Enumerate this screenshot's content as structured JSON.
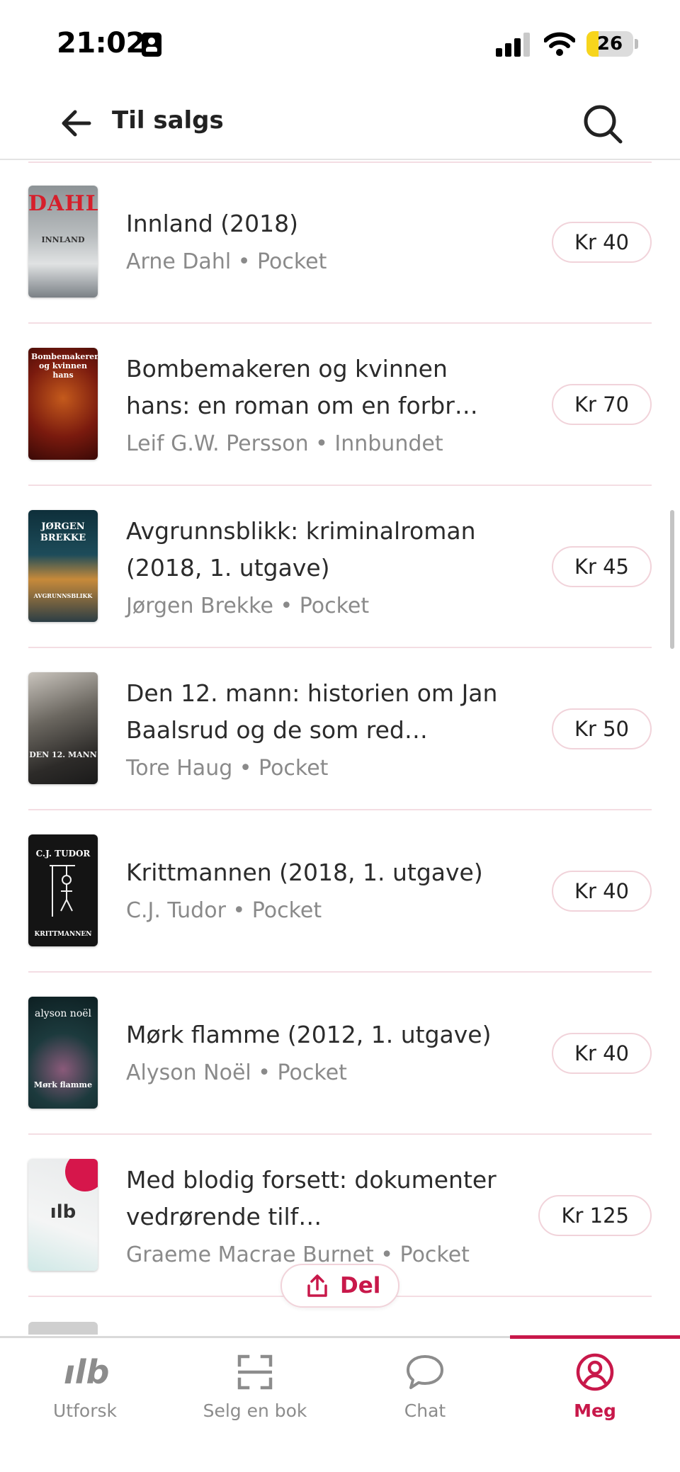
{
  "status_bar": {
    "time": "21:02",
    "battery": "26",
    "battery_level": 0.26
  },
  "header": {
    "title": "Til salgs"
  },
  "books": [
    {
      "title": "Innland (2018)",
      "author": "Arne Dahl",
      "format": "Pocket",
      "price": "Kr 40",
      "cover_text": "DAHL",
      "cover_sub": "INNLAND"
    },
    {
      "title": "Bombemakeren og kvinnen hans: en roman om en forbr…",
      "author": "Leif G.W. Persson",
      "format": "Innbundet",
      "price": "Kr 70",
      "cover_text": "Bombemakeren og kvinnen hans"
    },
    {
      "title": "Avgrunnsblikk: kriminalroman (2018, 1. utgave)",
      "author": "Jørgen Brekke",
      "format": "Pocket",
      "price": "Kr 45",
      "cover_text": "JØRGEN BREKKE",
      "cover_sub": "AVGRUNNSBLIKK"
    },
    {
      "title": "Den 12. mann: historien om Jan Baalsrud og de som red…",
      "author": "Tore Haug",
      "format": "Pocket",
      "price": "Kr 50",
      "cover_text": "DEN 12. MANN"
    },
    {
      "title": "Krittmannen (2018, 1. utgave)",
      "author": "C.J. Tudor",
      "format": "Pocket",
      "price": "Kr 40",
      "cover_text": "C.J. TUDOR",
      "cover_sub": "KRITTMANNEN"
    },
    {
      "title": "Mørk flamme (2012, 1. utgave)",
      "author": "Alyson Noël",
      "format": "Pocket",
      "price": "Kr 40",
      "cover_text": "alyson noël",
      "cover_sub": "Mørk flamme"
    },
    {
      "title": "Med blodig forsett: dokumenter vedrørende tilf…",
      "author": "Graeme Macrae Burnet",
      "format": "Pocket",
      "price": "Kr 125",
      "cover_text": "ılb"
    }
  ],
  "meta_separator": "•",
  "share": {
    "label": "Del"
  },
  "tabs": [
    {
      "label": "Utforsk",
      "icon": "logo-icon"
    },
    {
      "label": "Selg en bok",
      "icon": "scan-icon"
    },
    {
      "label": "Chat",
      "icon": "chat-bubble-icon"
    },
    {
      "label": "Meg",
      "icon": "profile-icon",
      "active": true
    }
  ],
  "colors": {
    "accent": "#c8184a",
    "divider": "#f4dde3",
    "muted": "#8a8a8a"
  }
}
